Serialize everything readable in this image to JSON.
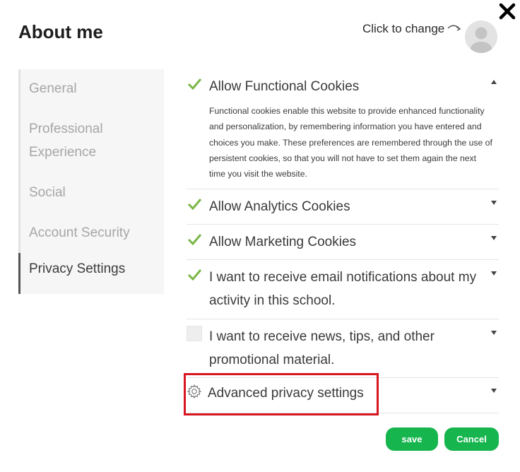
{
  "dialog": {
    "title": "About me",
    "change_photo_text": "Click to change"
  },
  "sidebar": {
    "items": [
      {
        "label": "General"
      },
      {
        "label": "Professional Experience"
      },
      {
        "label": "Social"
      },
      {
        "label": "Account Security"
      },
      {
        "label": "Privacy Settings",
        "active": true
      }
    ]
  },
  "privacy": {
    "items": [
      {
        "label": "Allow Functional Cookies",
        "checked": true,
        "expanded": true,
        "description": "Functional cookies enable this website to provide enhanced functionality and personalization, by remembering information you have entered and choices you make. These preferences are remembered through the use of persistent cookies, so that you will not have to set them again the next time you visit the website."
      },
      {
        "label": "Allow Analytics Cookies",
        "checked": true
      },
      {
        "label": "Allow Marketing Cookies",
        "checked": true
      },
      {
        "label": "I want to receive email notifications about my activity in this school.",
        "checked": true
      },
      {
        "label": "I want to receive news, tips, and other promotional material.",
        "checked": false
      }
    ],
    "advanced_label": "Advanced privacy settings"
  },
  "buttons": {
    "save_label": "save",
    "cancel_label": "Cancel"
  },
  "colors": {
    "accent_green": "#16b54e",
    "check_green": "#7ab648",
    "highlight_red": "#d7161f"
  },
  "icons": {
    "close": "close-icon",
    "avatar": "user-avatar-icon",
    "check": "checkmark-icon",
    "caret": "caret-icon",
    "gear": "gear-icon"
  }
}
